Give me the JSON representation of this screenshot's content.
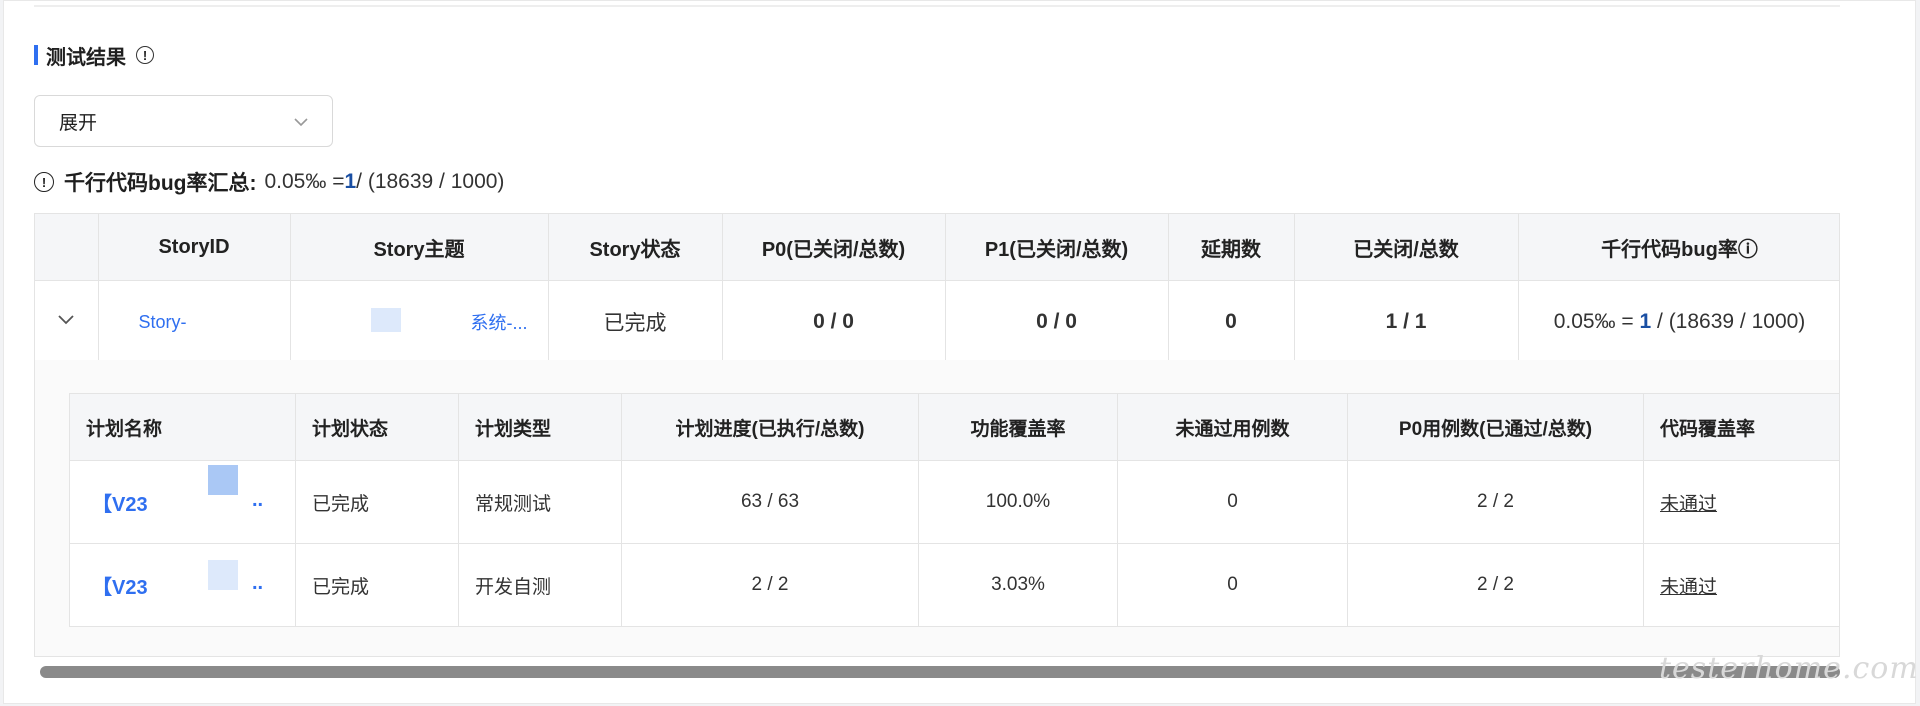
{
  "section": {
    "title": "测试结果"
  },
  "select": {
    "value": "展开"
  },
  "summary": {
    "label": "千行代码bug率汇总:",
    "prefix": "0.05‰ = ",
    "closed": "1",
    "suffix": " / (18639 / 1000)"
  },
  "story_table": {
    "headers": [
      "StoryID",
      "Story主题",
      "Story状态",
      "P0(已关闭/总数)",
      "P1(已关闭/总数)",
      "延期数",
      "已关闭/总数",
      "千行代码bug率ⓘ"
    ],
    "row": {
      "story_id": "Story-",
      "story_topic": "系统-...",
      "status": "已完成",
      "p0": "0 / 0",
      "p1": "0 / 0",
      "delayed": "0",
      "closed_total": "1 / 1",
      "bug_rate_prefix": "0.05‰ = ",
      "bug_rate_closed": "1",
      "bug_rate_suffix": " / (18639 / 1000)"
    }
  },
  "plan_table": {
    "headers": [
      "计划名称",
      "计划状态",
      "计划类型",
      "计划进度(已执行/总数)",
      "功能覆盖率",
      "未通过用例数",
      "P0用例数(已通过/总数)",
      "代码覆盖率"
    ],
    "rows": [
      {
        "name": "【V23",
        "name_suffix": "..",
        "status": "已完成",
        "type": "常规测试",
        "progress": "63 / 63",
        "coverage": "100.0%",
        "failed": "0",
        "p0": "2 / 2",
        "code_cov": "未通过"
      },
      {
        "name": "【V23",
        "name_suffix": "..",
        "status": "已完成",
        "type": "开发自测",
        "progress": "2 / 2",
        "coverage": "3.03%",
        "failed": "0",
        "p0": "2 / 2",
        "code_cov": "未通过"
      }
    ]
  },
  "watermark": "testerhome.com",
  "colors": {
    "accent": "#2f6ff0",
    "value_blue": "#1a4fa3",
    "fail_red": "#e5263b"
  }
}
